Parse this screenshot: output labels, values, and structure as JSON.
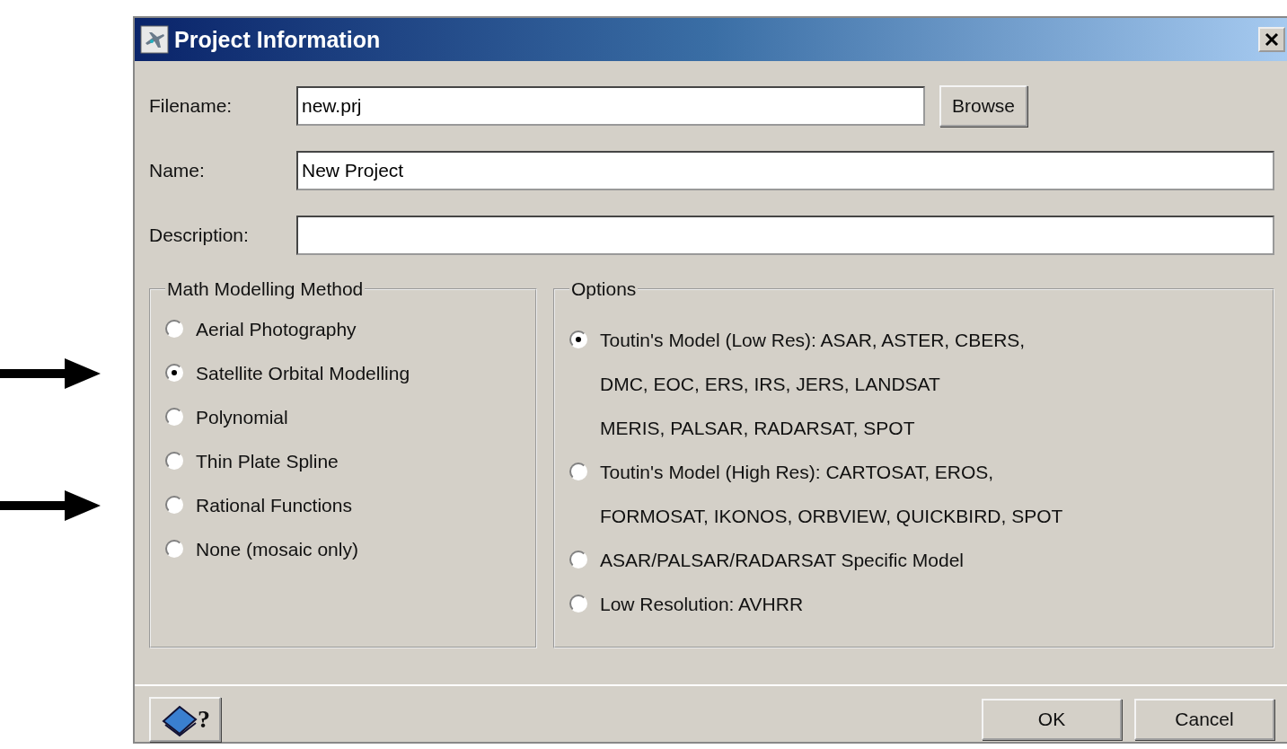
{
  "window": {
    "title": "Project Information"
  },
  "fields": [
    {
      "label": "Filename:",
      "value": "new.prj",
      "button": "Browse"
    },
    {
      "label": "Name:",
      "value": "New Project"
    },
    {
      "label": "Description:"
    }
  ],
  "help_button": {
    "label": "?"
  },
  "method_group": {
    "title": "Math Modelling Method",
    "items": [
      {
        "label": "Aerial Photography",
        "selected": false,
        "arrow": false
      },
      {
        "label": "Satellite Orbital Modelling",
        "selected": true,
        "arrow": true
      },
      {
        "label": "Polynomial",
        "selected": false,
        "arrow": false
      },
      {
        "label": "Thin Plate Spline",
        "selected": false,
        "arrow": false
      },
      {
        "label": "Rational Functions",
        "selected": false,
        "arrow": true
      },
      {
        "label": "None (mosaic only)",
        "selected": false,
        "arrow": false
      }
    ]
  },
  "options_group": {
    "title": "Options",
    "items": [
      {
        "lines": [
          "Toutin's Model (Low Res): ASAR, ASTER, CBERS,",
          "DMC, EOC, ERS, IRS, JERS, LANDSAT",
          "MERIS, PALSAR, RADARSAT, SPOT"
        ],
        "selected": true
      },
      {
        "lines": [
          "Toutin's Model (High Res): CARTOSAT, EROS,",
          "FORMOSAT, IKONOS, ORBVIEW, QUICKBIRD, SPOT"
        ],
        "selected": false
      },
      {
        "lines": [
          "ASAR/PALSAR/RADARSAT Specific Model"
        ],
        "selected": false
      },
      {
        "lines": [
          "Low Resolution: AVHRR"
        ],
        "selected": false
      }
    ]
  },
  "buttons": [
    "OK",
    "Cancel"
  ]
}
